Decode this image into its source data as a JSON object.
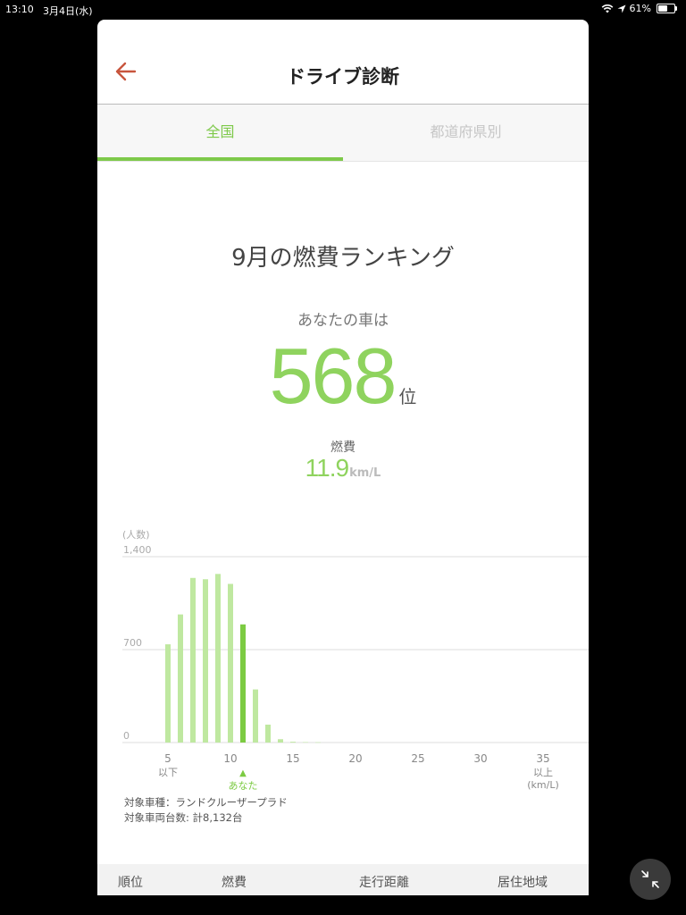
{
  "status": {
    "time": "13:10",
    "date": "3月4日(水)",
    "battery": "61%",
    "battery_level": 0.61
  },
  "header": {
    "title": "ドライブ診断"
  },
  "tabs": [
    {
      "label": "全国"
    },
    {
      "label": "都道府県別"
    }
  ],
  "ranking": {
    "title": "9月の燃費ランキング",
    "subtitle": "あなたの車は",
    "rank": "568",
    "rank_unit": "位",
    "fuel_label": "燃費",
    "fuel_value": "11.9",
    "fuel_unit": "km/L"
  },
  "chart_data": {
    "type": "bar",
    "ylabel": "(人数)",
    "ylim": [
      0,
      1400
    ],
    "yticks": [
      "1,400",
      "700",
      "0"
    ],
    "xtick_labels": [
      {
        "x": 5,
        "label": "5",
        "sub": "以下"
      },
      {
        "x": 10,
        "label": "10",
        "sub": ""
      },
      {
        "x": 15,
        "label": "15",
        "sub": ""
      },
      {
        "x": 20,
        "label": "20",
        "sub": ""
      },
      {
        "x": 25,
        "label": "25",
        "sub": ""
      },
      {
        "x": 30,
        "label": "30",
        "sub": ""
      },
      {
        "x": 35,
        "label": "35",
        "sub": "以上"
      }
    ],
    "xunit": "(km/L)",
    "you_marker": "▲",
    "you_label": "あなた",
    "you_x": 11,
    "bars": [
      {
        "x": 5,
        "value": 740
      },
      {
        "x": 6,
        "value": 965
      },
      {
        "x": 7,
        "value": 1240
      },
      {
        "x": 8,
        "value": 1230
      },
      {
        "x": 9,
        "value": 1270
      },
      {
        "x": 10,
        "value": 1195
      },
      {
        "x": 11,
        "value": 890
      },
      {
        "x": 12,
        "value": 400
      },
      {
        "x": 13,
        "value": 135
      },
      {
        "x": 14,
        "value": 25
      },
      {
        "x": 15,
        "value": 6
      },
      {
        "x": 16,
        "value": 3
      },
      {
        "x": 17,
        "value": 2
      }
    ],
    "colors": {
      "bar": "#bfe8a0",
      "highlight": "#7ccb42",
      "grid": "#dddddd"
    }
  },
  "notes": {
    "vehicle": "対象車種：ランドクルーザープラド",
    "count": "対象車両台数: 計8,132台"
  },
  "footer": {
    "columns": [
      "順位",
      "燃費",
      "走行距離",
      "居住地域"
    ]
  },
  "colors": {
    "accent": "#7ec94a",
    "back": "#c8553d"
  }
}
